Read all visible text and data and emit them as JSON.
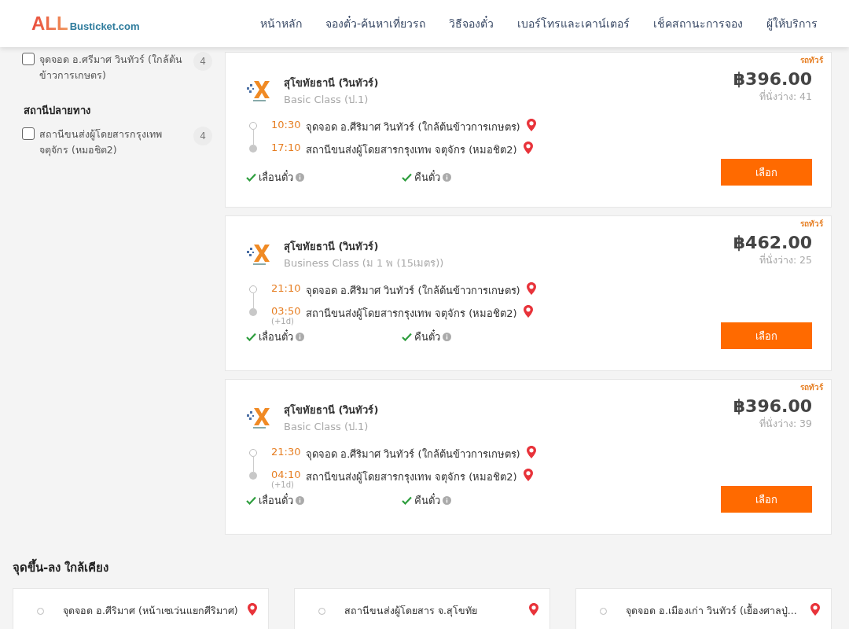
{
  "header": {
    "logo": {
      "main": "ALL",
      "sub": "Busticket.com"
    },
    "nav": [
      {
        "label": "หน้าหลัก"
      },
      {
        "label": "จองตั๋ว-ค้นหาเที่ยวรถ"
      },
      {
        "label": "วิธีจองตั๋ว"
      },
      {
        "label": "เบอร์โทรและเคาน์เตอร์"
      },
      {
        "label": "เช็คสถานะการจอง"
      },
      {
        "label": "ผู้ให้บริการ"
      }
    ]
  },
  "filters": [
    {
      "options": [
        {
          "label": "จุดจอด อ.ศรีมาศ วินทัวร์ (ใกล้ต้นข้าวการเกษตร)",
          "count": "4",
          "checked": false
        }
      ]
    },
    {
      "heading": "สถานีปลายทาง",
      "options": [
        {
          "label": "สถานีขนส่งผู้โดยสารกรุงเทพ จตุจักร (หมอชิต2)",
          "count": "4",
          "checked": false
        }
      ]
    }
  ],
  "trips": [
    {
      "operator": "สุโขทัยธานี (วินทัวร์)",
      "bus_class": "Basic Class (ป.1)",
      "tag": "รถทัวร์",
      "price": "฿396.00",
      "seats": "ที่นั่งว่าง: 41",
      "stops": [
        {
          "time": "10:30",
          "place": "จุดจอด อ.ศีริมาศ วินทัวร์ (ใกล้ต้นข้าวการเกษตร)"
        },
        {
          "time": "17:10",
          "place": "สถานีขนส่งผู้โดยสารกรุงเทพ จตุจักร (หมอชิต2)"
        }
      ],
      "features": [
        {
          "label": "เลื่อนตั๋ว",
          "available": true
        },
        {
          "label": "คืนตั๋ว",
          "available": true
        }
      ],
      "button": "เลือก"
    },
    {
      "operator": "สุโขทัยธานี (วินทัวร์)",
      "bus_class": "Business Class (ม 1 พ (15เมตร))",
      "tag": "รถทัวร์",
      "price": "฿462.00",
      "seats": "ที่นั่งว่าง: 25",
      "stops": [
        {
          "time": "21:10",
          "place": "จุดจอด อ.ศีริมาศ วินทัวร์ (ใกล้ต้นข้าวการเกษตร)"
        },
        {
          "time": "03:50",
          "day_offset": "(+1d)",
          "place": "สถานีขนส่งผู้โดยสารกรุงเทพ จตุจักร (หมอชิต2)"
        }
      ],
      "features": [
        {
          "label": "เลื่อนตั๋ว",
          "available": true
        },
        {
          "label": "คืนตั๋ว",
          "available": true
        }
      ],
      "button": "เลือก"
    },
    {
      "operator": "สุโขทัยธานี (วินทัวร์)",
      "bus_class": "Basic Class (ป.1)",
      "tag": "รถทัวร์",
      "price": "฿396.00",
      "seats": "ที่นั่งว่าง: 39",
      "stops": [
        {
          "time": "21:30",
          "place": "จุดจอด อ.ศีริมาศ วินทัวร์ (ใกล้ต้นข้าวการเกษตร)"
        },
        {
          "time": "04:10",
          "day_offset": "(+1d)",
          "place": "สถานีขนส่งผู้โดยสารกรุงเทพ จตุจักร (หมอชิต2)"
        }
      ],
      "features": [
        {
          "label": "เลื่อนตั๋ว",
          "available": true
        },
        {
          "label": "คืนตั๋ว",
          "available": true
        }
      ],
      "button": "เลือก"
    }
  ],
  "nearby": {
    "title": "จุดขึ้น-ลง ใกล้เคียง",
    "points": [
      {
        "name": "จุดจอด อ.ศีริมาศ (หน้าเซเว่นแยกศีริมาศ)"
      },
      {
        "name": "สถานีขนส่งผู้โดยสาร จ.สุโขทัย"
      },
      {
        "name": "จุดจอด อ.เมืองเก่า วินทัวร์ (เยื้องศาลปู่..."
      }
    ]
  }
}
